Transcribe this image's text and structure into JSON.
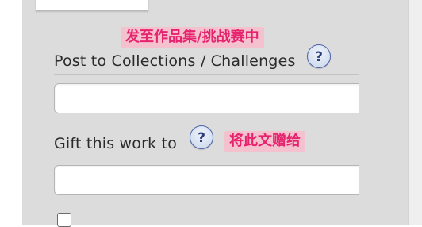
{
  "annotations": {
    "collections_translation": "发至作品集/挑战赛中",
    "gift_translation": "将此文赠给"
  },
  "collections": {
    "label": "Post to Collections / Challenges",
    "help_icon": "?",
    "input_value": ""
  },
  "gift": {
    "label": "Gift this work to",
    "help_icon": "?",
    "input_value": ""
  },
  "colors": {
    "panel_background": "#dcdcdc",
    "annotation_background": "#f4c2cf",
    "annotation_text": "#e6246e",
    "help_icon_border": "#4a62a8"
  },
  "icons": {
    "help": "help-icon",
    "checkbox": "checkbox"
  }
}
